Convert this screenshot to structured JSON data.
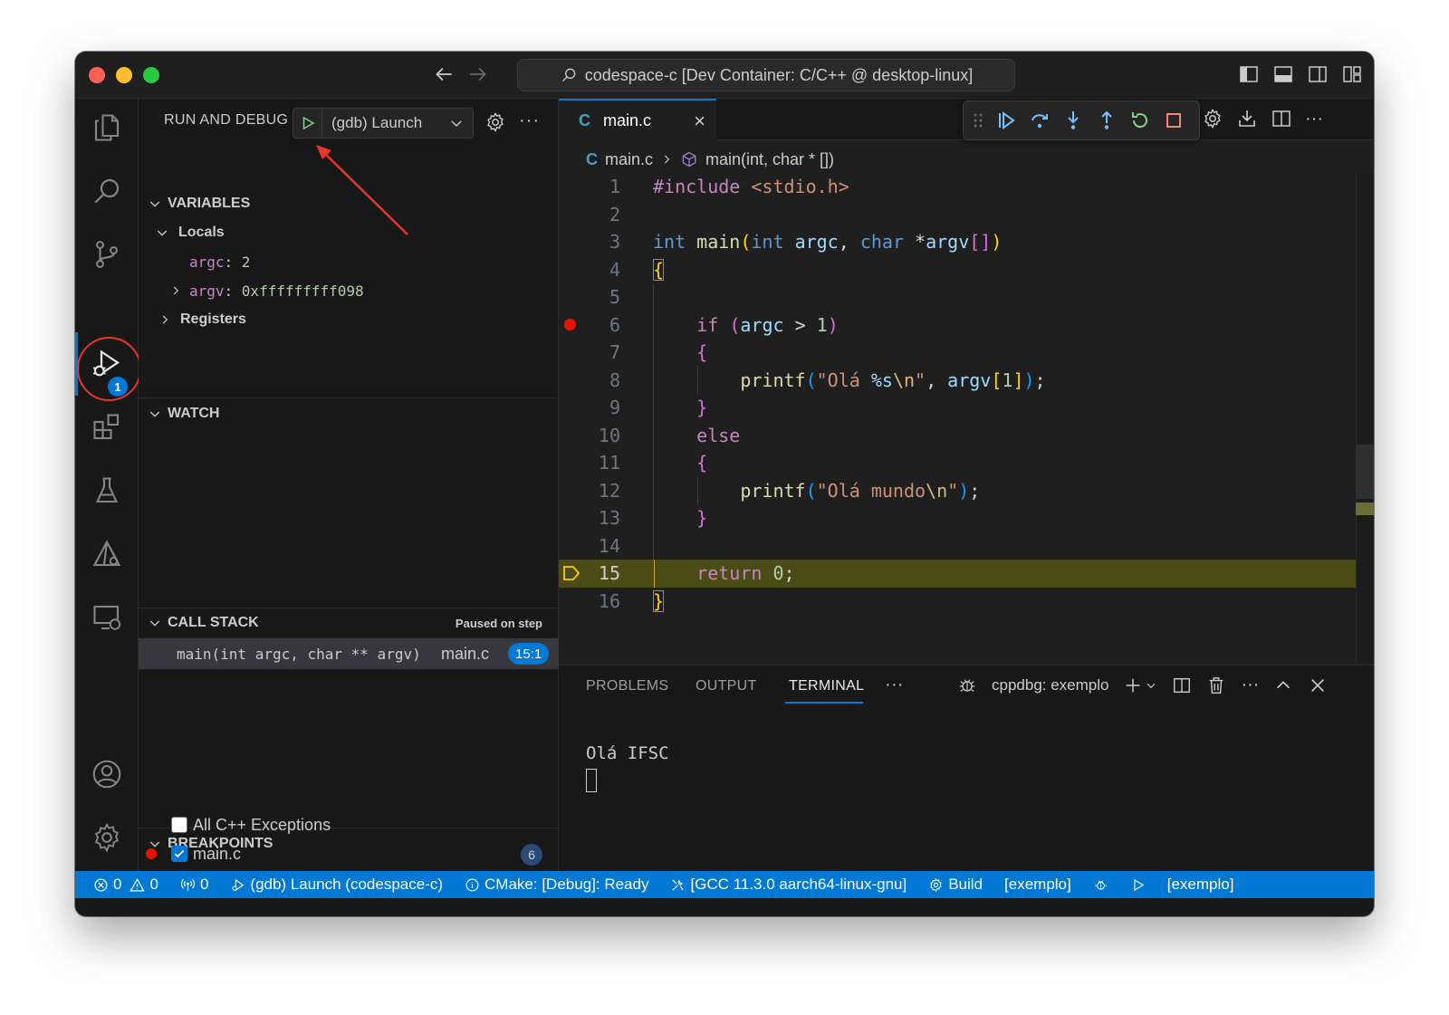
{
  "window": {
    "command_center": "codespace-c [Dev Container: C/C++ @ desktop-linux]"
  },
  "activity": {
    "debug_badge": "1"
  },
  "sidebar": {
    "title": "RUN AND DEBUG",
    "launch_config": "(gdb) Launch",
    "more": "···",
    "variables": {
      "header": "VARIABLES",
      "locals_label": "Locals",
      "vars": [
        {
          "name": "argc",
          "value": "2"
        },
        {
          "name": "argv",
          "value": "0xfffffffff098"
        }
      ],
      "registers_label": "Registers"
    },
    "watch": {
      "header": "WATCH"
    },
    "call_stack": {
      "header": "CALL STACK",
      "status": "Paused on step",
      "frame_function": "main(int argc, char ** argv)",
      "frame_file": "main.c",
      "frame_position": "15:1"
    },
    "breakpoints": {
      "header": "BREAKPOINTS",
      "items": [
        {
          "label": "All C++ Exceptions",
          "checked": false
        },
        {
          "label": "main.c",
          "checked": true,
          "count": "6"
        }
      ]
    }
  },
  "editor": {
    "tab_icon": "C",
    "tab_label": "main.c",
    "tab_close": "×",
    "breadcrumb_file": "main.c",
    "breadcrumb_symbol": "main(int, char * [])",
    "breakpoint_line": 6,
    "current_line": 15,
    "line_numbers": [
      "1",
      "2",
      "3",
      "4",
      "5",
      "6",
      "7",
      "8",
      "9",
      "10",
      "11",
      "12",
      "13",
      "14",
      "15",
      "16"
    ]
  },
  "panel": {
    "tabs": [
      "PROBLEMS",
      "OUTPUT",
      "TERMINAL"
    ],
    "active_tab": "TERMINAL",
    "more": "···",
    "terminal_name": "cppdbg: exemplo",
    "terminal_output": "Olá IFSC"
  },
  "statusbar": {
    "errors": "0",
    "warnings": "0",
    "ports": "0",
    "debug_session": "(gdb) Launch (codespace-c)",
    "cmake_status": "CMake: [Debug]: Ready",
    "kit": "[GCC 11.3.0 aarch64-linux-gnu]",
    "build": "Build",
    "target": "[exemplo]",
    "launch_target": "[exemplo]"
  },
  "colors": {
    "accent": "#0078d4",
    "breakpoint": "#e51400",
    "current_line_bg": "#4b4b18",
    "annotation": "#e5372a"
  }
}
